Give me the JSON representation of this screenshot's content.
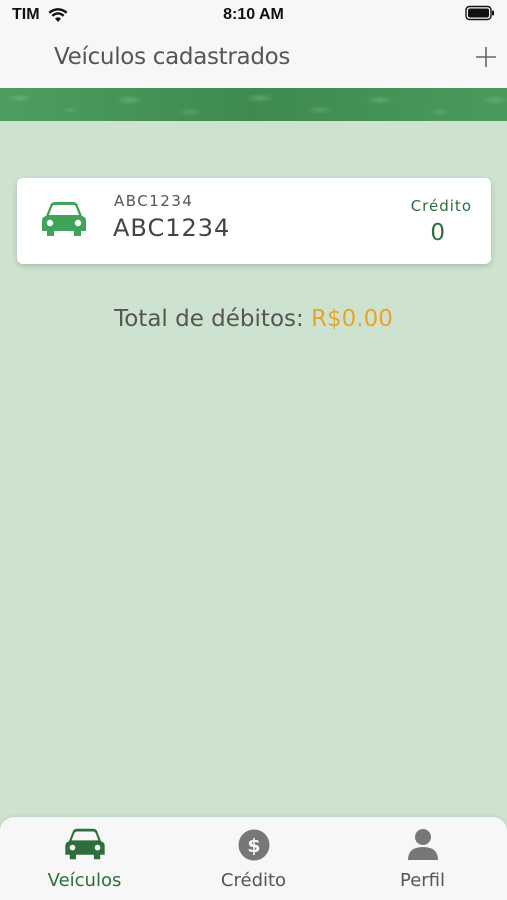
{
  "status_bar": {
    "carrier": "TIM",
    "time": "8:10 AM"
  },
  "nav": {
    "title": "Veículos cadastrados",
    "add_icon": "plus-icon"
  },
  "vehicles": [
    {
      "plate_small": "ABC1234",
      "plate_large": "ABC1234",
      "credit_label": "Crédito",
      "credit_value": "0",
      "icon": "car-icon"
    }
  ],
  "summary": {
    "total_label": "Total de débitos:",
    "total_value": "R$0.00"
  },
  "tabs": [
    {
      "label": "Veículos",
      "icon": "car-icon",
      "active": true
    },
    {
      "label": "Crédito",
      "icon": "dollar-coin-icon",
      "active": false
    },
    {
      "label": "Perfil",
      "icon": "user-icon",
      "active": false
    }
  ],
  "colors": {
    "background": "#cde3cf",
    "brand_green": "#2d6e3c",
    "icon_green": "#3fa45a",
    "amount_orange": "#e8a42b",
    "inactive_gray": "#555555"
  }
}
